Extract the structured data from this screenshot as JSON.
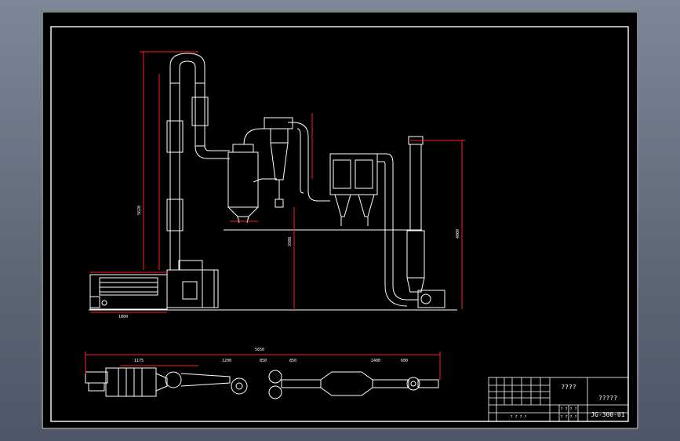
{
  "drawing": {
    "title_block": {
      "name_field": "????",
      "company_field": "?????",
      "drawing_number": "JG-300-01",
      "row_placeholders": [
        "? ? ? ?",
        "? ? ? ?",
        "? ? ? ?"
      ]
    },
    "dimension_labels": {
      "overall_length": "5650",
      "segment_a": "1175",
      "segment_b": "1200",
      "segment_c": "850",
      "segment_d": "850",
      "segment_e": "2400",
      "segment_f": "600",
      "height_total": "5620",
      "height_cyclone": "3500",
      "height_stack": "4000",
      "base_length": "1000"
    }
  }
}
